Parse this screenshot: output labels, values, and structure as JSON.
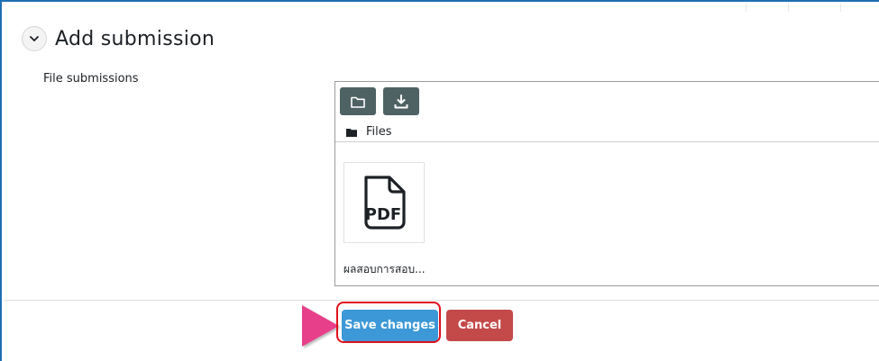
{
  "section": {
    "title": "Add submission",
    "toggle_icon": "chevron-down-icon"
  },
  "field": {
    "label": "File submissions"
  },
  "filemanager": {
    "toolbar": [
      {
        "icon": "folder-icon"
      },
      {
        "icon": "download-icon"
      }
    ],
    "path_label": "Files",
    "files": [
      {
        "name": "ผลสอบการสอบ...",
        "type": "PDF",
        "icon": "pdf-file-icon"
      }
    ]
  },
  "actions": {
    "save_label": "Save changes",
    "cancel_label": "Cancel"
  },
  "colors": {
    "frame_border": "#1f6fb5",
    "save": "#3c98d7",
    "cancel": "#c44a4a",
    "toolbar_button": "#4f6263",
    "highlight_ring": "#e0101b",
    "pointer_arrow": "#e83f8b"
  }
}
